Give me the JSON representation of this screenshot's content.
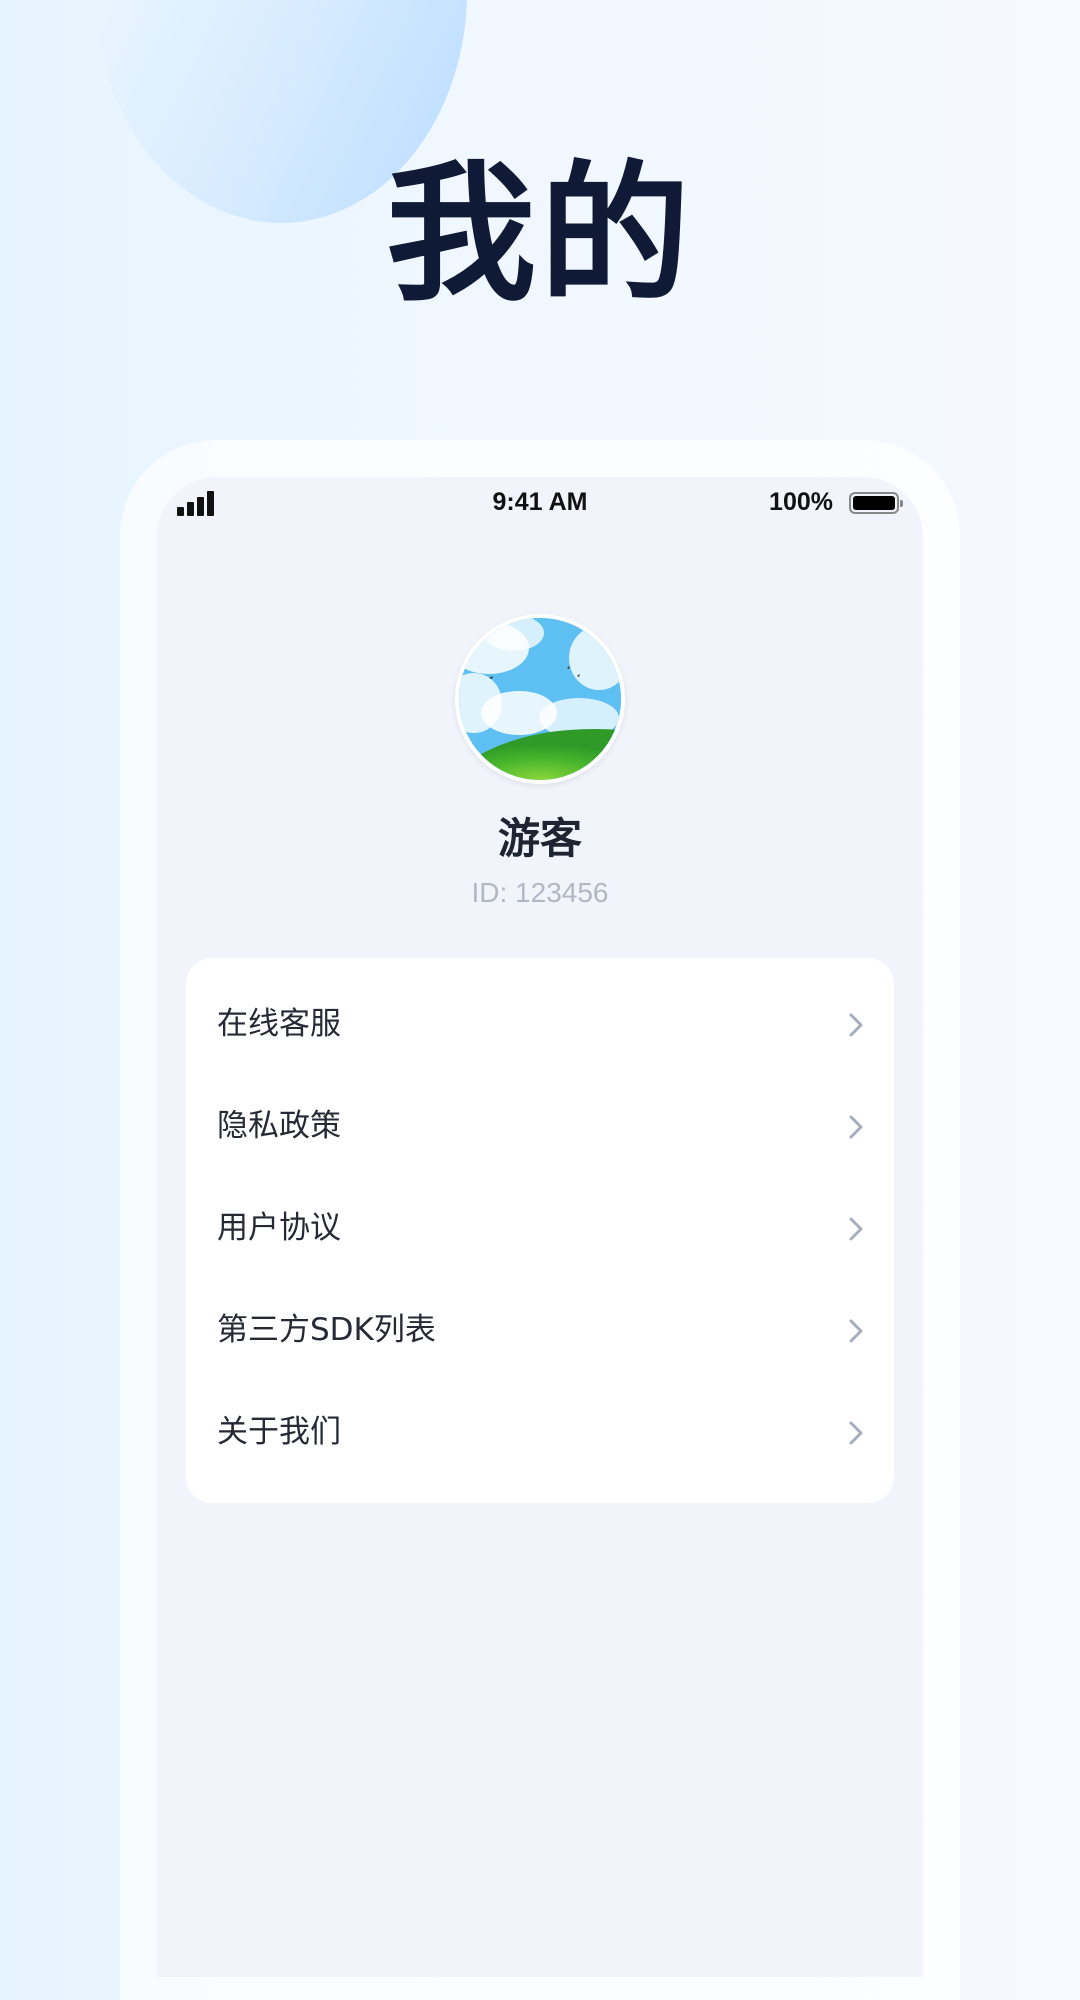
{
  "hero": {
    "title": "我的"
  },
  "status_bar": {
    "time": "9:41 AM",
    "battery": "100%",
    "icons": [
      "signal-icon",
      "battery-icon"
    ]
  },
  "profile": {
    "name": "游客",
    "id_text": "ID: 123456"
  },
  "menu": {
    "items": [
      {
        "label": "在线客服",
        "icon": "chevron-right-icon"
      },
      {
        "label": "隐私政策",
        "icon": "chevron-right-icon"
      },
      {
        "label": "用户协议",
        "icon": "chevron-right-icon"
      },
      {
        "label": "第三方SDK列表",
        "icon": "chevron-right-icon"
      },
      {
        "label": "关于我们",
        "icon": "chevron-right-icon"
      }
    ]
  },
  "colors": {
    "title": "#0f1a36",
    "screen_bg": "#f1f4fb",
    "card_bg": "#ffffff",
    "id_text": "#b2b7c6",
    "chevron": "#a6adbf"
  }
}
